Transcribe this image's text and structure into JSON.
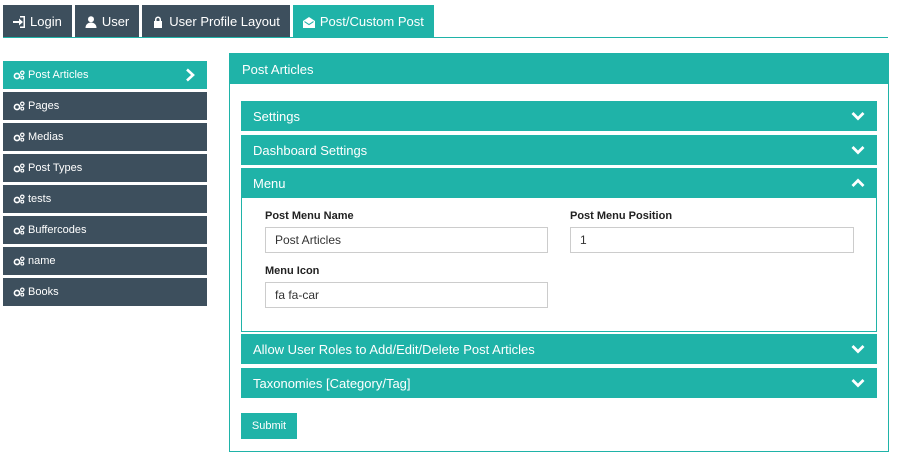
{
  "tabs": [
    {
      "label": "Login",
      "icon": "sign-in-icon"
    },
    {
      "label": "User",
      "icon": "user-icon"
    },
    {
      "label": "User Profile Layout",
      "icon": "lock-icon"
    },
    {
      "label": "Post/Custom Post",
      "icon": "envelope-open-icon",
      "active": true
    }
  ],
  "sidebar": {
    "items": [
      {
        "label": "Post Articles",
        "active": true
      },
      {
        "label": "Pages"
      },
      {
        "label": "Medias"
      },
      {
        "label": "Post Types"
      },
      {
        "label": "tests"
      },
      {
        "label": "Buffercodes"
      },
      {
        "label": "name"
      },
      {
        "label": "Books"
      }
    ]
  },
  "panel": {
    "title": "Post Articles",
    "sections": {
      "settings": "Settings",
      "dashboard": "Dashboard Settings",
      "menu": "Menu",
      "roles": "Allow User Roles to Add/Edit/Delete Post Articles",
      "taxonomies": "Taxonomies [Category/Tag]"
    },
    "menu_form": {
      "name_label": "Post Menu Name",
      "name_value": "Post Articles",
      "position_label": "Post Menu Position",
      "position_value": "1",
      "icon_label": "Menu Icon",
      "icon_value": "fa fa-car"
    },
    "submit_label": "Submit"
  },
  "colors": {
    "accent": "#1fb3a8",
    "dark": "#3d4f5d"
  }
}
